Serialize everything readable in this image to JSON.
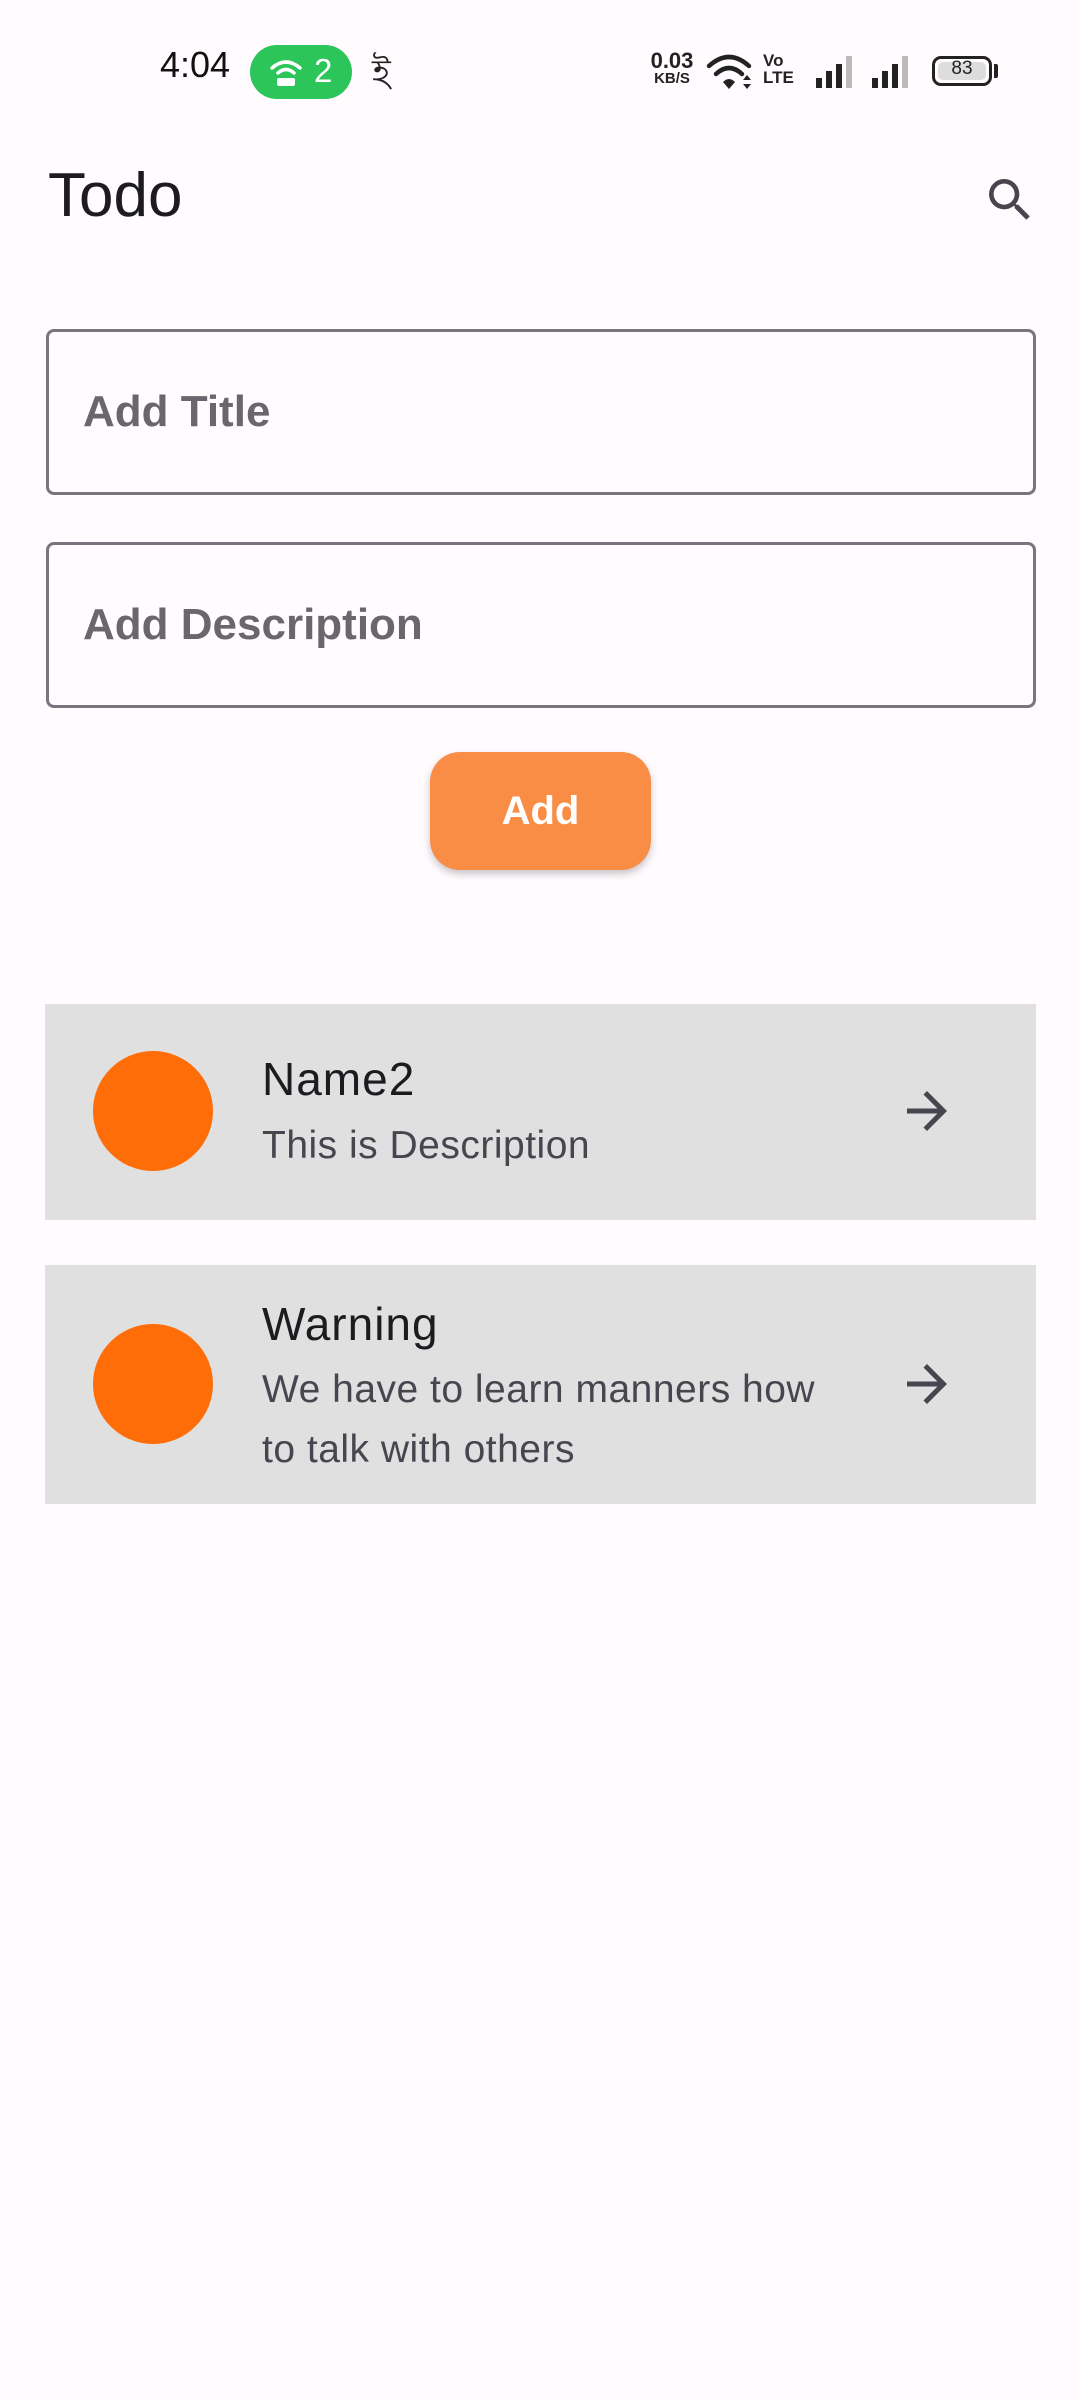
{
  "status_bar": {
    "time": "4:04",
    "hotspot_count": "2",
    "misc_glyph": "ই",
    "net_speed_value": "0.03",
    "net_speed_unit": "KB/S",
    "volte": "Vo LTE",
    "battery_level": "83"
  },
  "app_bar": {
    "title": "Todo",
    "search_icon": "search-icon"
  },
  "form": {
    "title_placeholder": "Add Title",
    "title_value": "",
    "description_placeholder": "Add Description",
    "description_value": "",
    "add_label": "Add"
  },
  "todos": [
    {
      "title": "Name2",
      "description": "This is Description",
      "icon": "arrow-right-icon"
    },
    {
      "title": "Warning",
      "description": "We have to learn manners how to talk with others",
      "icon": "arrow-right-icon"
    }
  ],
  "colors": {
    "background": "#fffbfe",
    "accent_button": "#f98d46",
    "avatar": "#fe6d07",
    "card": "#e0e0e0",
    "hotspot": "#2cc55a"
  }
}
